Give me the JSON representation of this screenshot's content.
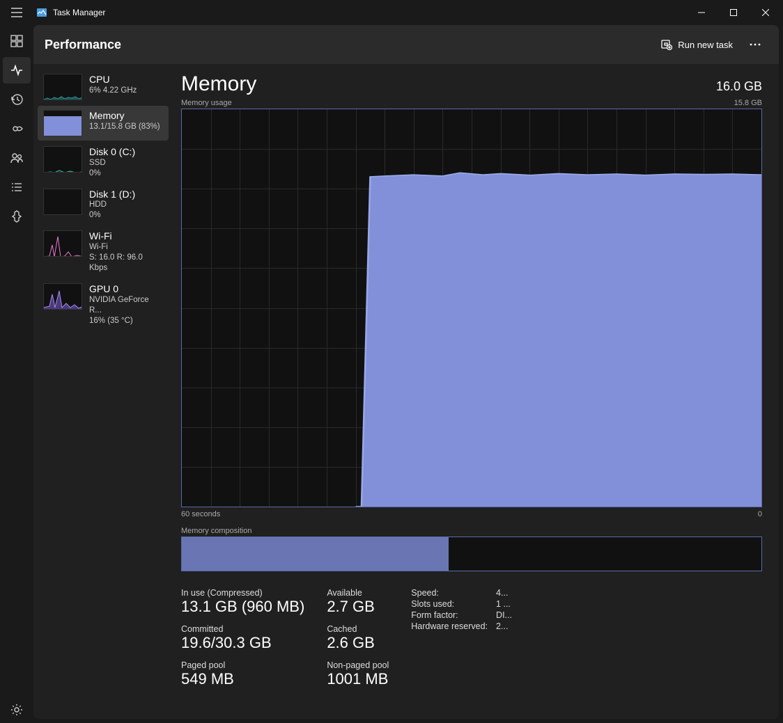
{
  "window": {
    "title": "Task Manager"
  },
  "header": {
    "title": "Performance",
    "run_new_task": "Run new task"
  },
  "sidebar": {
    "items": [
      {
        "title": "CPU",
        "sub": "6% 4.22 GHz",
        "sub2": ""
      },
      {
        "title": "Memory",
        "sub": "13.1/15.8 GB (83%)",
        "sub2": ""
      },
      {
        "title": "Disk 0 (C:)",
        "sub": "SSD",
        "sub2": "0%"
      },
      {
        "title": "Disk 1 (D:)",
        "sub": "HDD",
        "sub2": "0%"
      },
      {
        "title": "Wi-Fi",
        "sub": "Wi-Fi",
        "sub2": "S: 16.0 R: 96.0 Kbps"
      },
      {
        "title": "GPU 0",
        "sub": "NVIDIA GeForce R...",
        "sub2": "16% (35 °C)"
      }
    ]
  },
  "detail": {
    "title": "Memory",
    "total": "16.0 GB",
    "usage_label": "Memory usage",
    "usage_max": "15.8 GB",
    "xaxis_left": "60 seconds",
    "xaxis_right": "0",
    "composition_label": "Memory composition",
    "stats": {
      "in_use_label": "In use (Compressed)",
      "in_use_value": "13.1 GB (960 MB)",
      "available_label": "Available",
      "available_value": "2.7 GB",
      "committed_label": "Committed",
      "committed_value": "19.6/30.3 GB",
      "cached_label": "Cached",
      "cached_value": "2.6 GB",
      "paged_label": "Paged pool",
      "paged_value": "549 MB",
      "nonpaged_label": "Non-paged pool",
      "nonpaged_value": "1001 MB"
    },
    "info": {
      "speed_k": "Speed:",
      "speed_v": "4...",
      "slots_k": "Slots used:",
      "slots_v": "1 ...",
      "form_k": "Form factor:",
      "form_v": "DI...",
      "hw_k": "Hardware reserved:",
      "hw_v": "2..."
    }
  },
  "chart_data": {
    "type": "area",
    "title": "Memory usage",
    "xlabel": "seconds",
    "ylabel": "GB",
    "xlim": [
      60,
      0
    ],
    "ylim": [
      0,
      15.8
    ],
    "series": [
      {
        "name": "Memory",
        "x": [
          60,
          58,
          56,
          54,
          52,
          50,
          48,
          46,
          44,
          42,
          40,
          38,
          36,
          34,
          32,
          30,
          28,
          26,
          24,
          22,
          20,
          18,
          16,
          14,
          12,
          10,
          8,
          6,
          4,
          2,
          0
        ],
        "y": [
          0,
          0,
          0,
          0,
          0,
          0,
          0,
          0,
          0,
          0,
          0,
          0,
          0,
          0,
          0.2,
          13.1,
          13.1,
          13.1,
          13.2,
          13.1,
          13.2,
          13.1,
          13.2,
          13.1,
          13.2,
          13.1,
          13.2,
          13.1,
          13.1,
          13.1,
          13.1
        ]
      }
    ],
    "composition": {
      "in_use_pct": 46,
      "modified_pct": 0,
      "standby_pct": 0,
      "free_pct": 54
    }
  }
}
